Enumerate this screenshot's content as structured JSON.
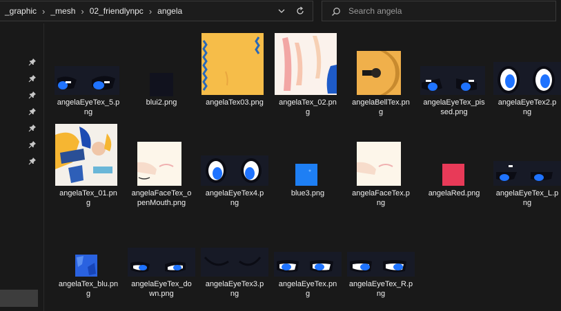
{
  "breadcrumbs": [
    "_graphic",
    "_mesh",
    "02_friendlynpc",
    "angela"
  ],
  "search": {
    "placeholder": "Search angela"
  },
  "icons": {
    "address_dropdown": "chevron-down-icon",
    "refresh": "refresh-icon",
    "search": "search-icon",
    "quick_access_pin": "pin-icon"
  },
  "colors": {
    "background": "#191919",
    "text": "#ffffff",
    "selection": "#3d3d3d"
  },
  "files": [
    {
      "name": "angelaEyeTex_5.png",
      "line1": "angelaEyeTex_5.p",
      "line2": "ng"
    },
    {
      "name": "blui2.png",
      "line1": "blui2.png",
      "line2": ""
    },
    {
      "name": "angelaTex03.png",
      "line1": "angelaTex03.png",
      "line2": ""
    },
    {
      "name": "angelaTex_02.png",
      "line1": "angelaTex_02.pn",
      "line2": "g"
    },
    {
      "name": "angelaBellTex.png",
      "line1": "angelaBellTex.pn",
      "line2": "g"
    },
    {
      "name": "angelaEyeTex_pissed.png",
      "line1": "angelaEyeTex_pis",
      "line2": "sed.png"
    },
    {
      "name": "angelaEyeTex2.png",
      "line1": "angelaEyeTex2.p",
      "line2": "ng"
    },
    {
      "name": "angelaTex_01.png",
      "line1": "angelaTex_01.pn",
      "line2": "g"
    },
    {
      "name": "angelaFaceTex_openMouth.png",
      "line1": "angelaFaceTex_o",
      "line2": "penMouth.png"
    },
    {
      "name": "angelaEyeTex4.png",
      "line1": "angelaEyeTex4.p",
      "line2": "ng"
    },
    {
      "name": "blue3.png",
      "line1": "blue3.png",
      "line2": ""
    },
    {
      "name": "angelaFaceTex.png",
      "line1": "angelaFaceTex.p",
      "line2": "ng"
    },
    {
      "name": "angelaRed.png",
      "line1": "angelaRed.png",
      "line2": ""
    },
    {
      "name": "angelaEyeTex_L.png",
      "line1": "angelaEyeTex_L.p",
      "line2": "ng"
    },
    {
      "name": "angelaTex_blu.png",
      "line1": "angelaTex_blu.pn",
      "line2": "g"
    },
    {
      "name": "angelaEyeTex_down.png",
      "line1": "angelaEyeTex_do",
      "line2": "wn.png"
    },
    {
      "name": "angelaEyeTex3.png",
      "line1": "angelaEyeTex3.p",
      "line2": "ng"
    },
    {
      "name": "angelaEyeTex.png",
      "line1": "angelaEyeTex.pn",
      "line2": "g"
    },
    {
      "name": "angelaEyeTex_R.png",
      "line1": "angelaEyeTex_R.p",
      "line2": "ng"
    }
  ]
}
